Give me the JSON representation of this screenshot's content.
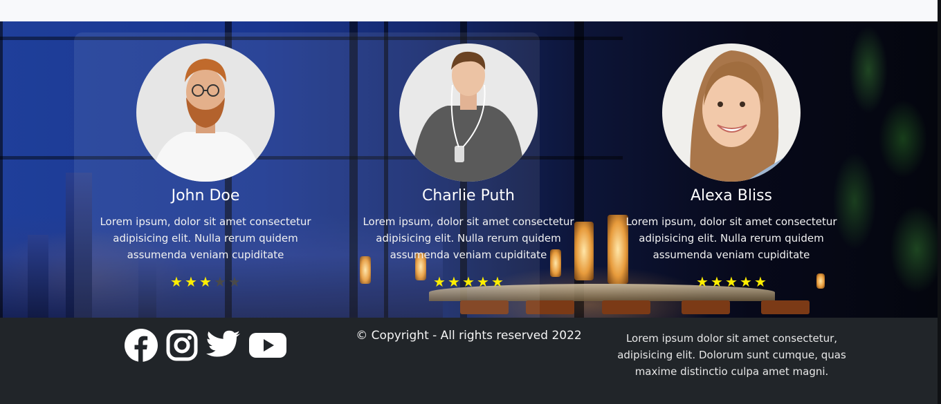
{
  "testimonials": [
    {
      "name": "John Doe",
      "text": "Lorem ipsum, dolor sit amet consectetur adipisicing elit. Nulla rerum quidem assumenda veniam cupiditate",
      "rating": 3,
      "max_rating": 5,
      "avatar": "bearded-man-portrait"
    },
    {
      "name": "Charlie Puth",
      "text": "Lorem ipsum, dolor sit amet consectetur adipisicing elit. Nulla rerum quidem assumenda veniam cupiditate",
      "rating": 5,
      "max_rating": 5,
      "avatar": "young-man-portrait"
    },
    {
      "name": "Alexa Bliss",
      "text": "Lorem ipsum, dolor sit amet consectetur adipisicing elit. Nulla rerum quidem assumenda veniam cupiditate",
      "rating": 5,
      "max_rating": 5,
      "avatar": "smiling-woman-portrait"
    }
  ],
  "footer": {
    "social_icons": [
      "facebook-icon",
      "instagram-icon",
      "twitter-icon",
      "youtube-icon"
    ],
    "copyright": "© Copyright - All rights reserved 2022",
    "text": "Lorem ipsum dolor sit amet consectetur, adipisicing elit. Dolorum sunt cumque, quas maxime distinctio culpa amet magni."
  },
  "colors": {
    "star_active": "#ffee00",
    "star_inactive": "#4a4a4a",
    "footer_bg": "#212529",
    "top_strip_bg": "#f8f9fb"
  }
}
